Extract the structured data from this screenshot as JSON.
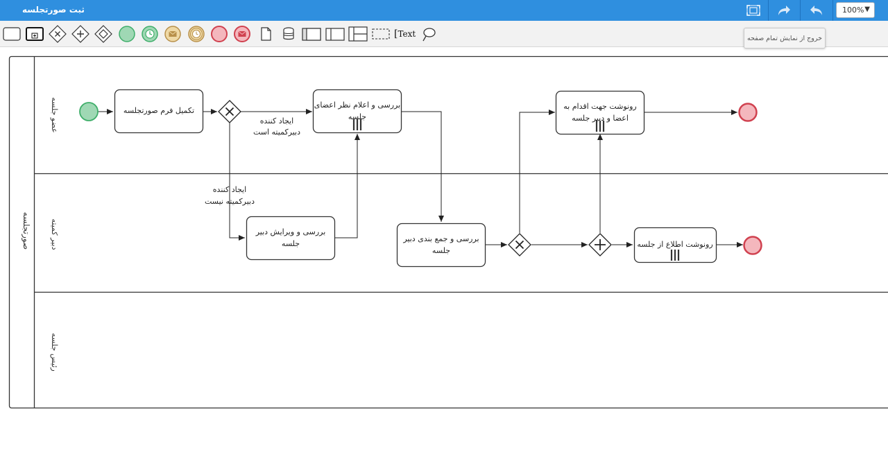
{
  "window": {
    "title": "ثبت صورتجلسه"
  },
  "header": {
    "zoom_value": "100%",
    "tooltip": "خروج از نمایش تمام صفحه"
  },
  "toolbar": {
    "text_tool_label": "Text",
    "tools": [
      "task-tool",
      "subprocess-tool",
      "exclusive-gateway-tool",
      "parallel-gateway-tool",
      "event-gateway-tool",
      "start-event-tool",
      "timer-start-event-tool",
      "message-start-event-tool",
      "timer-intermediate-event-tool",
      "end-event-tool",
      "message-end-event-tool",
      "data-object-tool",
      "data-store-tool",
      "pool-tool",
      "lane-tool",
      "lane-split-tool",
      "group-tool",
      "text-annotation-tool",
      "connect-tool"
    ]
  },
  "diagram": {
    "pool_label": "صورتجلسه",
    "lanes": [
      "عضو جلسه",
      "دبیر کمیته",
      "رئیس جلسه"
    ],
    "tasks": {
      "complete_form": "تکمیل فرم صورتجلسه",
      "review_members_1": "بررسی و اعلام نظر اعضای",
      "review_members_2": "جلسه",
      "copy_members_1": "رونوشت جهت اقدام به",
      "copy_members_2": "اعضا و دبیر جلسه",
      "review_edit_1": "بررسی و ویرایش دبیر",
      "review_edit_2": "جلسه",
      "categorize_1": "بررسی و جمع بندی دبیر",
      "categorize_2": "جلسه",
      "notify": "رونوشت اطلاع از جلسه"
    },
    "flows": {
      "creator_is_secretary_1": "ایجاد کننده",
      "creator_is_secretary_2": "دبیرکمیته است",
      "creator_not_secretary_1": "ایجاد کننده",
      "creator_not_secretary_2": "دبیرکمیته نیست"
    },
    "colors": {
      "start_fill": "#9fd8b4",
      "start_stroke": "#3fae6a",
      "end_fill": "#f4b7bd",
      "end_stroke": "#d0414f"
    }
  }
}
